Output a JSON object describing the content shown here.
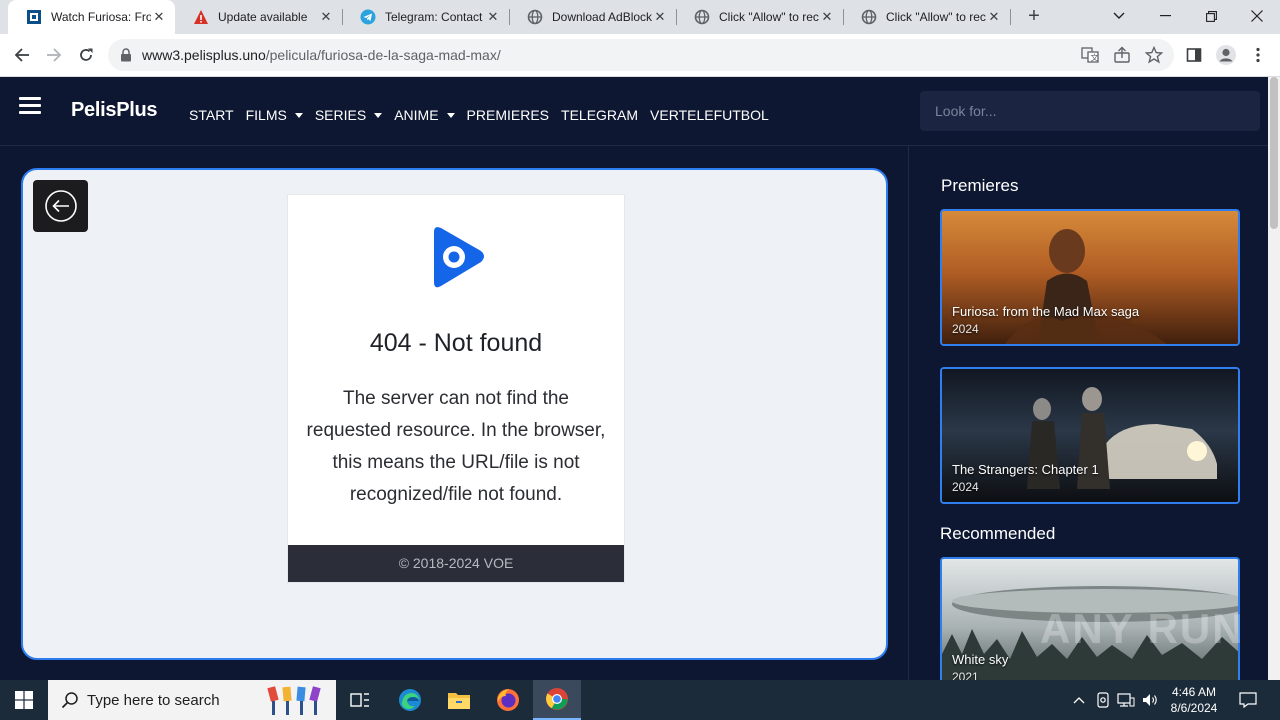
{
  "browser": {
    "tabs": [
      {
        "title": "Watch Furiosa: From the Mad Max saga",
        "icon": "pelisplus-favicon",
        "active": true
      },
      {
        "title": "Update available",
        "icon": "warning-icon",
        "active": false
      },
      {
        "title": "Telegram: Contact",
        "icon": "telegram-icon",
        "active": false
      },
      {
        "title": "Download AdBlock",
        "icon": "globe-icon",
        "active": false
      },
      {
        "title": "Click \"Allow\" to receive",
        "icon": "globe-icon",
        "active": false
      },
      {
        "title": "Click \"Allow\" to receive",
        "icon": "globe-icon",
        "active": false
      }
    ],
    "close_glyph": "✕",
    "new_tab_glyph": "+",
    "address": {
      "host": "www3.pelisplus.uno",
      "path": "/pelicula/furiosa-de-la-saga-mad-max/"
    }
  },
  "site": {
    "brand": "PelisPlus",
    "nav": [
      {
        "label": "START",
        "dropdown": false
      },
      {
        "label": "FILMS",
        "dropdown": true
      },
      {
        "label": "SERIES",
        "dropdown": true
      },
      {
        "label": "ANIME",
        "dropdown": true
      },
      {
        "label": "PREMIERES",
        "dropdown": false
      },
      {
        "label": "TELEGRAM",
        "dropdown": false
      },
      {
        "label": "VERTELEFUTBOL",
        "dropdown": false
      }
    ],
    "search_placeholder": "Look for...",
    "player": {
      "error_title": "404 - Not found",
      "error_message": "The server can not find the requested resource. In the browser, this means the URL/file is not recognized/file not found.",
      "footer": "© 2018-2024 VOE"
    },
    "sidebar": {
      "premieres_title": "Premieres",
      "premieres": [
        {
          "title": "Furiosa: from the Mad Max saga",
          "year": "2024"
        },
        {
          "title": "The Strangers: Chapter 1",
          "year": "2024"
        }
      ],
      "recommended_title": "Recommended",
      "recommended": [
        {
          "title": "White sky",
          "year": "2021"
        }
      ]
    },
    "watermark": "ANY RUN",
    "accent_color": "#2c7df0",
    "background_color": "#0e1731"
  },
  "taskbar": {
    "search_placeholder": "Type here to search",
    "apps": [
      "task-view-icon",
      "edge-icon",
      "file-explorer-icon",
      "firefox-icon",
      "chrome-icon"
    ],
    "time": "4:46 AM",
    "date": "8/6/2024"
  }
}
